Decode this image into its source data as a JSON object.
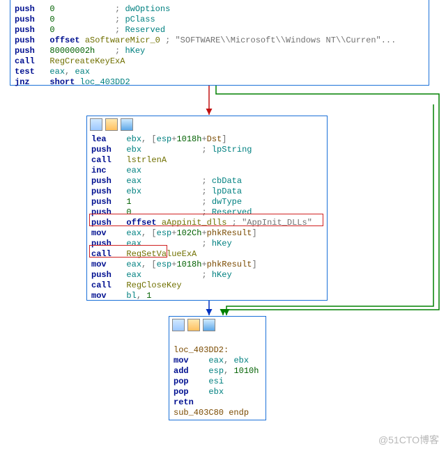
{
  "watermark": "@51CTO博客",
  "icons": {
    "a": "graph-icon",
    "b": "palette-icon",
    "c": "window-icon"
  },
  "block_top": {
    "lines": [
      [
        [
          "push   ",
          "c-navy"
        ],
        [
          "0",
          "c-num"
        ],
        [
          "            ; ",
          "c-gray"
        ],
        [
          "dwOptions",
          "c-teal"
        ]
      ],
      [
        [
          "push   ",
          "c-navy"
        ],
        [
          "0",
          "c-num"
        ],
        [
          "            ; ",
          "c-gray"
        ],
        [
          "pClass",
          "c-teal"
        ]
      ],
      [
        [
          "push   ",
          "c-navy"
        ],
        [
          "0",
          "c-num"
        ],
        [
          "            ; ",
          "c-gray"
        ],
        [
          "Reserved",
          "c-teal"
        ]
      ],
      [
        [
          "push   ",
          "c-navy"
        ],
        [
          "offset ",
          "c-navy"
        ],
        [
          "aSoftwareMicr_0",
          "c-olive"
        ],
        [
          " ; ",
          "c-gray"
        ],
        [
          "\"SOFTWARE\\\\Microsoft\\\\Windows NT\\\\Curren\"...",
          "c-gray"
        ]
      ],
      [
        [
          "push   ",
          "c-navy"
        ],
        [
          "80000002h",
          "c-num"
        ],
        [
          "    ; ",
          "c-gray"
        ],
        [
          "hKey",
          "c-teal"
        ]
      ],
      [
        [
          "call   ",
          "c-navy"
        ],
        [
          "RegCreateKeyExA",
          "c-olive"
        ]
      ],
      [
        [
          "test   ",
          "c-navy"
        ],
        [
          "eax",
          "c-teal"
        ],
        [
          ", ",
          "c-gray"
        ],
        [
          "eax",
          "c-teal"
        ]
      ],
      [
        [
          "jnz    ",
          "c-navy"
        ],
        [
          "short ",
          "c-navy"
        ],
        [
          "loc_403DD2",
          "c-teal"
        ]
      ]
    ]
  },
  "block_mid": {
    "lines": [
      [
        [
          "lea    ",
          "c-navy"
        ],
        [
          "ebx",
          "c-teal"
        ],
        [
          ", [",
          "c-gray"
        ],
        [
          "esp",
          "c-teal"
        ],
        [
          "+",
          "c-gray"
        ],
        [
          "1018h",
          "c-num"
        ],
        [
          "+",
          "c-gray"
        ],
        [
          "Dst",
          "c-brown"
        ],
        [
          "]",
          "c-gray"
        ]
      ],
      [
        [
          "push   ",
          "c-navy"
        ],
        [
          "ebx",
          "c-teal"
        ],
        [
          "            ; ",
          "c-gray"
        ],
        [
          "lpString",
          "c-teal"
        ]
      ],
      [
        [
          "call   ",
          "c-navy"
        ],
        [
          "lstrlenA",
          "c-olive"
        ]
      ],
      [
        [
          "inc    ",
          "c-navy"
        ],
        [
          "eax",
          "c-teal"
        ]
      ],
      [
        [
          "push   ",
          "c-navy"
        ],
        [
          "eax",
          "c-teal"
        ],
        [
          "            ; ",
          "c-gray"
        ],
        [
          "cbData",
          "c-teal"
        ]
      ],
      [
        [
          "push   ",
          "c-navy"
        ],
        [
          "ebx",
          "c-teal"
        ],
        [
          "            ; ",
          "c-gray"
        ],
        [
          "lpData",
          "c-teal"
        ]
      ],
      [
        [
          "push   ",
          "c-navy"
        ],
        [
          "1",
          "c-num"
        ],
        [
          "              ; ",
          "c-gray"
        ],
        [
          "dwType",
          "c-teal"
        ]
      ],
      [
        [
          "push   ",
          "c-navy"
        ],
        [
          "0",
          "c-num"
        ],
        [
          "              ; ",
          "c-gray"
        ],
        [
          "Reserved",
          "c-teal"
        ]
      ],
      [
        [
          "push   ",
          "c-navy"
        ],
        [
          "offset ",
          "c-navy"
        ],
        [
          "aAppinit_dlls",
          "c-olive"
        ],
        [
          " ; ",
          "c-gray"
        ],
        [
          "\"AppInit_DLLs\"",
          "c-gray"
        ]
      ],
      [
        [
          "mov    ",
          "c-navy"
        ],
        [
          "eax",
          "c-teal"
        ],
        [
          ", [",
          "c-gray"
        ],
        [
          "esp",
          "c-teal"
        ],
        [
          "+",
          "c-gray"
        ],
        [
          "102Ch",
          "c-num"
        ],
        [
          "+",
          "c-gray"
        ],
        [
          "phkResult",
          "c-brown"
        ],
        [
          "]",
          "c-gray"
        ]
      ],
      [
        [
          "push   ",
          "c-navy"
        ],
        [
          "eax",
          "c-teal"
        ],
        [
          "            ; ",
          "c-gray"
        ],
        [
          "hKey",
          "c-teal"
        ]
      ],
      [
        [
          "call   ",
          "c-navy"
        ],
        [
          "RegSetValueExA",
          "c-olive"
        ]
      ],
      [
        [
          "mov    ",
          "c-navy"
        ],
        [
          "eax",
          "c-teal"
        ],
        [
          ", [",
          "c-gray"
        ],
        [
          "esp",
          "c-teal"
        ],
        [
          "+",
          "c-gray"
        ],
        [
          "1018h",
          "c-num"
        ],
        [
          "+",
          "c-gray"
        ],
        [
          "phkResult",
          "c-brown"
        ],
        [
          "]",
          "c-gray"
        ]
      ],
      [
        [
          "push   ",
          "c-navy"
        ],
        [
          "eax",
          "c-teal"
        ],
        [
          "            ; ",
          "c-gray"
        ],
        [
          "hKey",
          "c-teal"
        ]
      ],
      [
        [
          "call   ",
          "c-navy"
        ],
        [
          "RegCloseKey",
          "c-olive"
        ]
      ],
      [
        [
          "mov    ",
          "c-navy"
        ],
        [
          "bl",
          "c-teal"
        ],
        [
          ", ",
          "c-gray"
        ],
        [
          "1",
          "c-num"
        ]
      ]
    ]
  },
  "block_bot": {
    "lines": [
      [
        [
          "",
          "c-gray"
        ]
      ],
      [
        [
          "loc_403DD2:",
          "c-brown"
        ]
      ],
      [
        [
          "mov    ",
          "c-navy"
        ],
        [
          "eax",
          "c-teal"
        ],
        [
          ", ",
          "c-gray"
        ],
        [
          "ebx",
          "c-teal"
        ]
      ],
      [
        [
          "add    ",
          "c-navy"
        ],
        [
          "esp",
          "c-teal"
        ],
        [
          ", ",
          "c-gray"
        ],
        [
          "1010h",
          "c-num"
        ]
      ],
      [
        [
          "pop    ",
          "c-navy"
        ],
        [
          "esi",
          "c-teal"
        ]
      ],
      [
        [
          "pop    ",
          "c-navy"
        ],
        [
          "ebx",
          "c-teal"
        ]
      ],
      [
        [
          "retn",
          "c-navy"
        ]
      ],
      [
        [
          "sub_403C80 endp",
          "c-brown"
        ]
      ]
    ]
  }
}
